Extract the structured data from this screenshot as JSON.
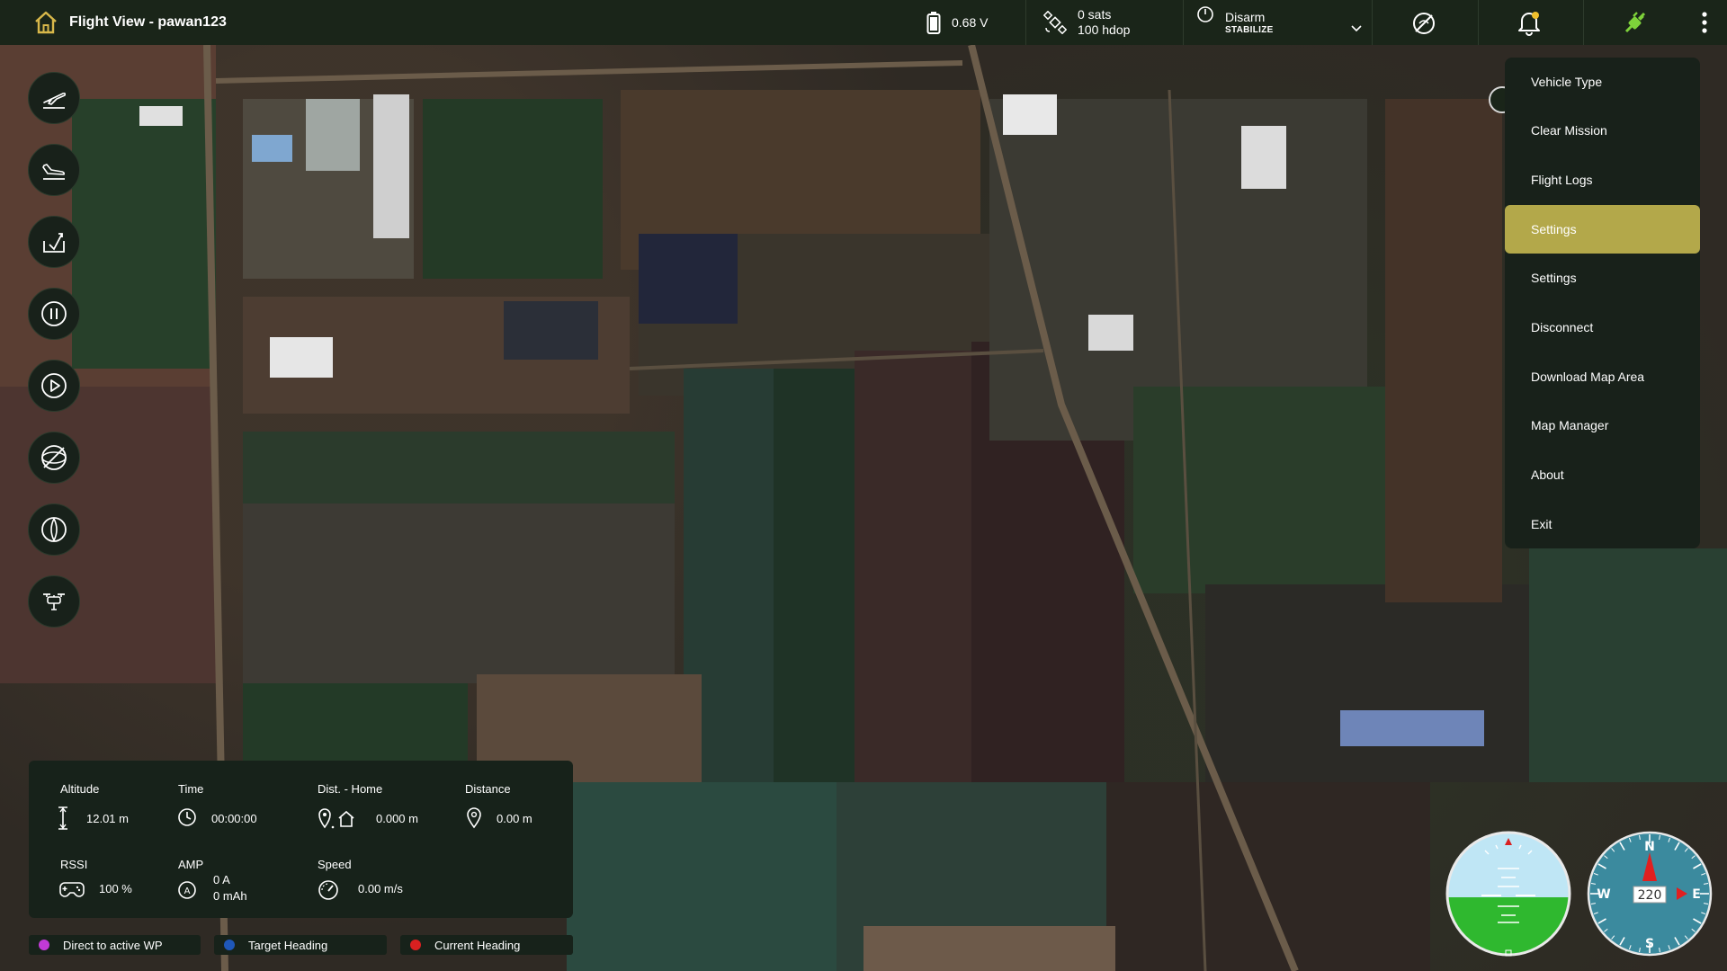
{
  "app": {
    "title": "Flight View - pawan123"
  },
  "status": {
    "battery_voltage": "0.68 V",
    "gps_sats": "0 sats",
    "gps_hdop": "100 hdop",
    "arm_state": "Disarm",
    "flight_mode": "STABILIZE"
  },
  "menu": {
    "items": [
      {
        "label": "Vehicle Type",
        "active": false
      },
      {
        "label": "Clear Mission",
        "active": false
      },
      {
        "label": "Flight Logs",
        "active": false
      },
      {
        "label": "Settings",
        "active": true
      },
      {
        "label": "Settings",
        "active": false
      },
      {
        "label": "Disconnect",
        "active": false
      },
      {
        "label": "Download Map Area",
        "active": false
      },
      {
        "label": "Map Manager",
        "active": false
      },
      {
        "label": "About",
        "active": false
      },
      {
        "label": "Exit",
        "active": false
      }
    ],
    "active_color": "#b3a84a"
  },
  "tools": [
    {
      "icon": "takeoff-icon"
    },
    {
      "icon": "land-icon"
    },
    {
      "icon": "return-to-launch-icon"
    },
    {
      "icon": "pause-icon"
    },
    {
      "icon": "play-icon"
    },
    {
      "icon": "gimbal-off-icon"
    },
    {
      "icon": "propeller-icon"
    },
    {
      "icon": "drone-icon"
    }
  ],
  "telemetry": {
    "altitude": {
      "label": "Altitude",
      "value": "12.01 m"
    },
    "time": {
      "label": "Time",
      "value": "00:00:00"
    },
    "dist_home": {
      "label": "Dist. - Home",
      "value": "0.000 m"
    },
    "distance": {
      "label": "Distance",
      "value": "0.00 m"
    },
    "rssi": {
      "label": "RSSI",
      "value": "100 %"
    },
    "amp": {
      "label": "AMP",
      "value": "0 A",
      "value2": "0 mAh"
    },
    "speed": {
      "label": "Speed",
      "value": "0.00 m/s"
    }
  },
  "legend": [
    {
      "label": "Direct to active WP",
      "color": "#c13ad6"
    },
    {
      "label": "Target Heading",
      "color": "#1f57b8"
    },
    {
      "label": "Current Heading",
      "color": "#d92020"
    }
  ],
  "compass": {
    "heading": "220",
    "north": "N",
    "south": "S",
    "east": "E",
    "west": "W"
  },
  "colors": {
    "topbar": "#1a2519",
    "panel": "#17221a",
    "connected_icon": "#7ed23a",
    "sky": "#bfe6f5",
    "ground": "#2fb82f"
  }
}
